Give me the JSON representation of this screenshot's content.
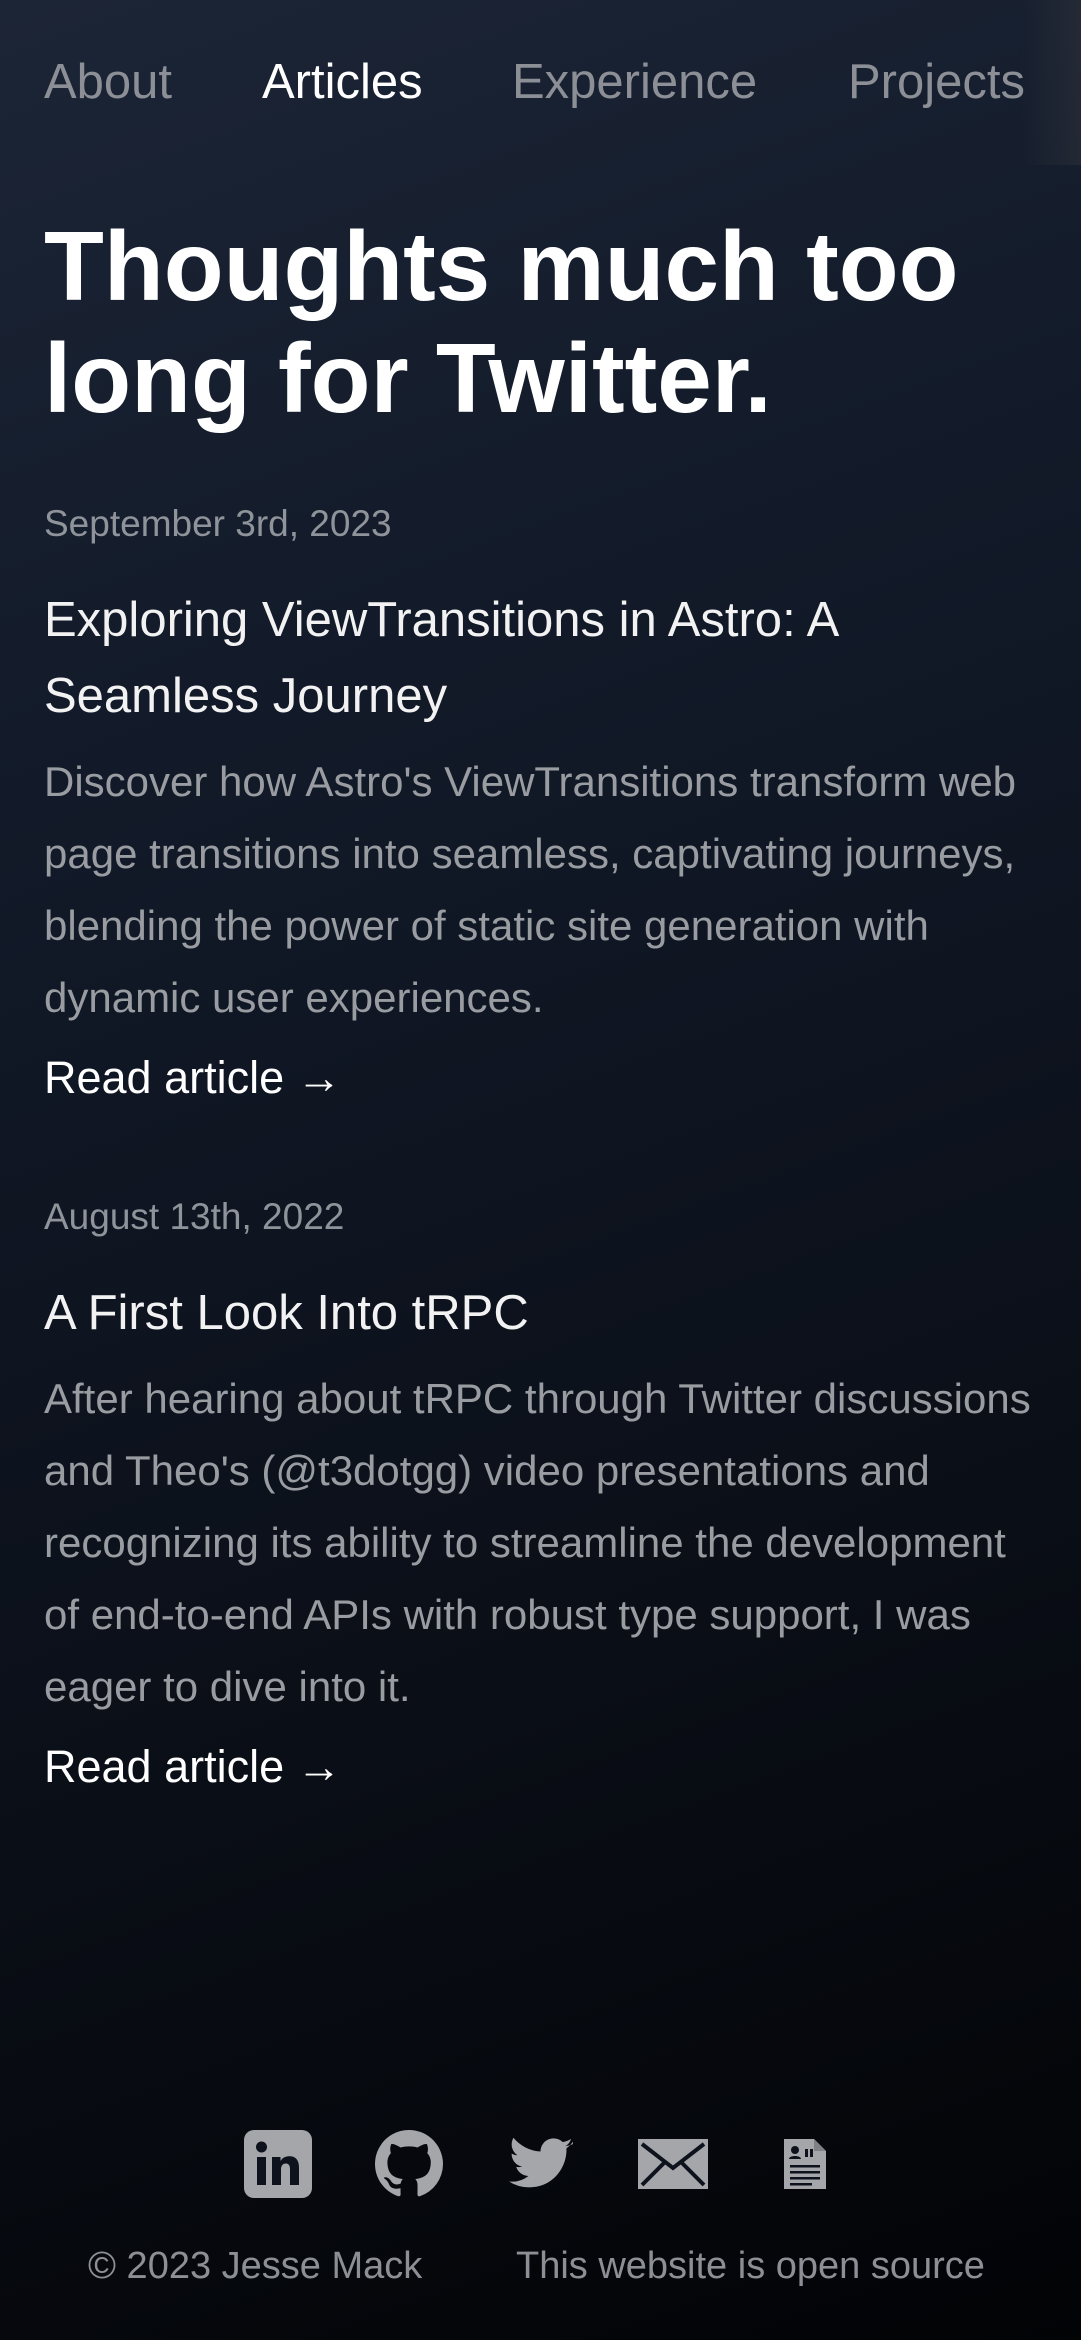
{
  "nav": {
    "items": [
      {
        "label": "About"
      },
      {
        "label": "Articles"
      },
      {
        "label": "Experience"
      },
      {
        "label": "Projects"
      }
    ],
    "active": "Articles"
  },
  "hero": {
    "title": "Thoughts much too long for Twitter."
  },
  "articles": [
    {
      "date": "September 3rd, 2023",
      "title": "Exploring ViewTransitions in Astro: A Seamless Journey",
      "description": "Discover how Astro's ViewTransitions transform web page transitions into seamless, captivating journeys, blending the power of static site generation with dynamic user experiences.",
      "link_label": "Read article →"
    },
    {
      "date": "August 13th, 2022",
      "title": "A First Look Into tRPC",
      "description": "After hearing about tRPC through Twitter discussions and Theo's (@t3dotgg) video presentations and recognizing its ability to streamline the development of end-to-end APIs with robust type support, I was eager to dive into it.",
      "link_label": "Read article →"
    }
  ],
  "socials": [
    {
      "icon": "linkedin-icon"
    },
    {
      "icon": "github-icon"
    },
    {
      "icon": "twitter-icon"
    },
    {
      "icon": "mail-icon"
    },
    {
      "icon": "cv-document-icon"
    }
  ],
  "footer": {
    "copyright": "© 2023 Jesse Mack",
    "source_link": "This website is open source"
  },
  "colors": {
    "text_primary": "#ffffff",
    "text_muted": "#8c8f95",
    "icon": "#a4a6aa",
    "background_top": "#1c2536",
    "background_bottom": "#020305"
  }
}
